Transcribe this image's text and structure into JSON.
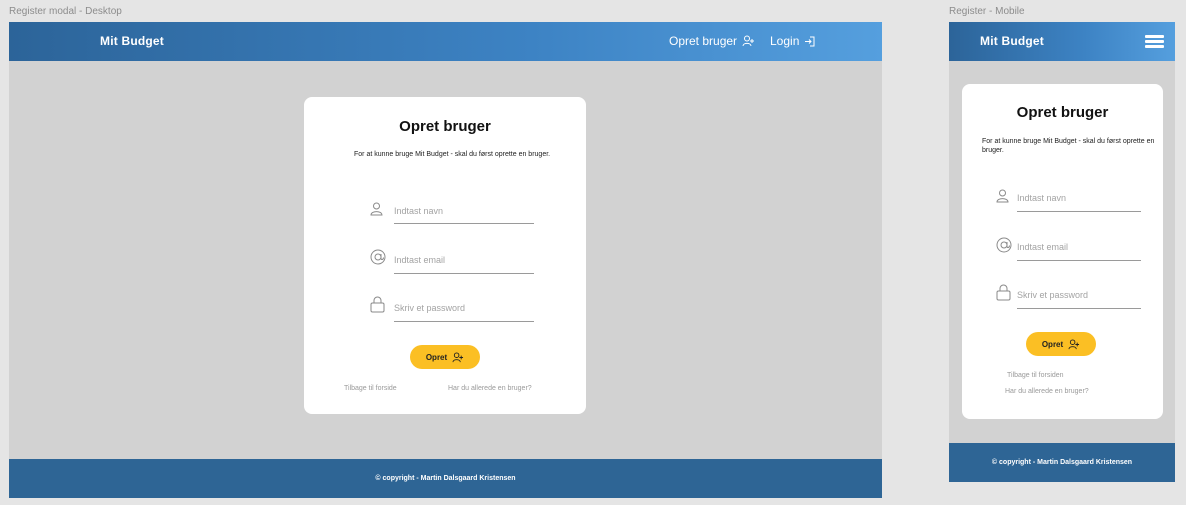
{
  "desktop": {
    "frame_label": "Register modal - Desktop",
    "brand": "Mit Budget",
    "nav": {
      "register_label": "Opret bruger",
      "login_label": "Login"
    },
    "card": {
      "title": "Opret bruger",
      "description": "For at kunne bruge Mit Budget - skal du først oprette en bruger.",
      "name_placeholder": "Indtast navn",
      "email_placeholder": "Indtast email",
      "password_placeholder": "Skriv et password",
      "submit_label": "Opret",
      "back_link": "Tilbage til forside",
      "login_link": "Har du allerede en bruger?"
    },
    "footer": "© copyright - Martin Dalsgaard Kristensen"
  },
  "mobile": {
    "frame_label": "Register - Mobile",
    "brand": "Mit Budget",
    "card": {
      "title": "Opret bruger",
      "description": "For at kunne bruge Mit Budget - skal du først oprette en bruger.",
      "name_placeholder": "Indtast navn",
      "email_placeholder": "Indtast email",
      "password_placeholder": "Skriv et password",
      "submit_label": "Opret",
      "back_link": "Tilbage til forsiden",
      "login_link": "Har du allerede en bruger?"
    },
    "footer": "© copyright - Martin Dalsgaard Kristensen"
  },
  "colors": {
    "accent": "#fbbf24",
    "header_start": "#2c6499",
    "header_end": "#559fde",
    "footer": "#2e6595",
    "backdrop": "#d2d2d2"
  }
}
